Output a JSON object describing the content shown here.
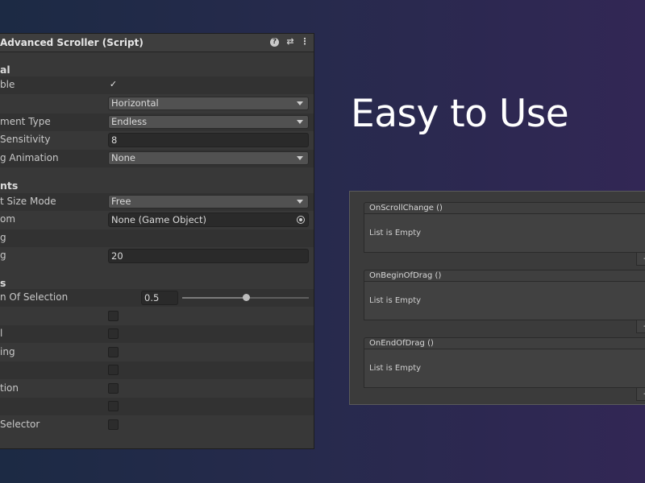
{
  "inspector": {
    "title": "Advanced Scroller (Script)",
    "header_icons": [
      "help-icon",
      "preset-icon",
      "menu-icon"
    ],
    "sections": {
      "general": "al",
      "elements": "nts",
      "other": "s"
    },
    "rows": {
      "r1_label": "ble",
      "r1_checked": "✓",
      "r2_label": "",
      "r2_value": "Horizontal",
      "r3_label": "ment Type",
      "r3_value": "Endless",
      "r4_label": "Sensitivity",
      "r4_value": "8",
      "r5_label": "g Animation",
      "r5_value": "None",
      "r6_label": "t Size Mode",
      "r6_value": "Free",
      "r7_label": "om",
      "r7_value": "None (Game Object)",
      "r8_label": "g",
      "r9_label": "g",
      "r9_value": "20",
      "r10_label": "n Of Selection",
      "r10_value": "0.5",
      "r10_level": 0.5,
      "r11_label": "",
      "r12_label": "l",
      "r13_label": "ing",
      "r14_label": "",
      "r15_label": "tion",
      "r16_label": "",
      "r17_label": "Selector"
    }
  },
  "headline": "Easy to Use",
  "events": [
    {
      "name": "OnScrollChange ()",
      "empty_text": "List is Empty",
      "remove": "-"
    },
    {
      "name": "OnBeginOfDrag ()",
      "empty_text": "List is Empty",
      "remove": "-"
    },
    {
      "name": "OnEndOfDrag ()",
      "empty_text": "List is Empty",
      "remove": "-"
    }
  ]
}
